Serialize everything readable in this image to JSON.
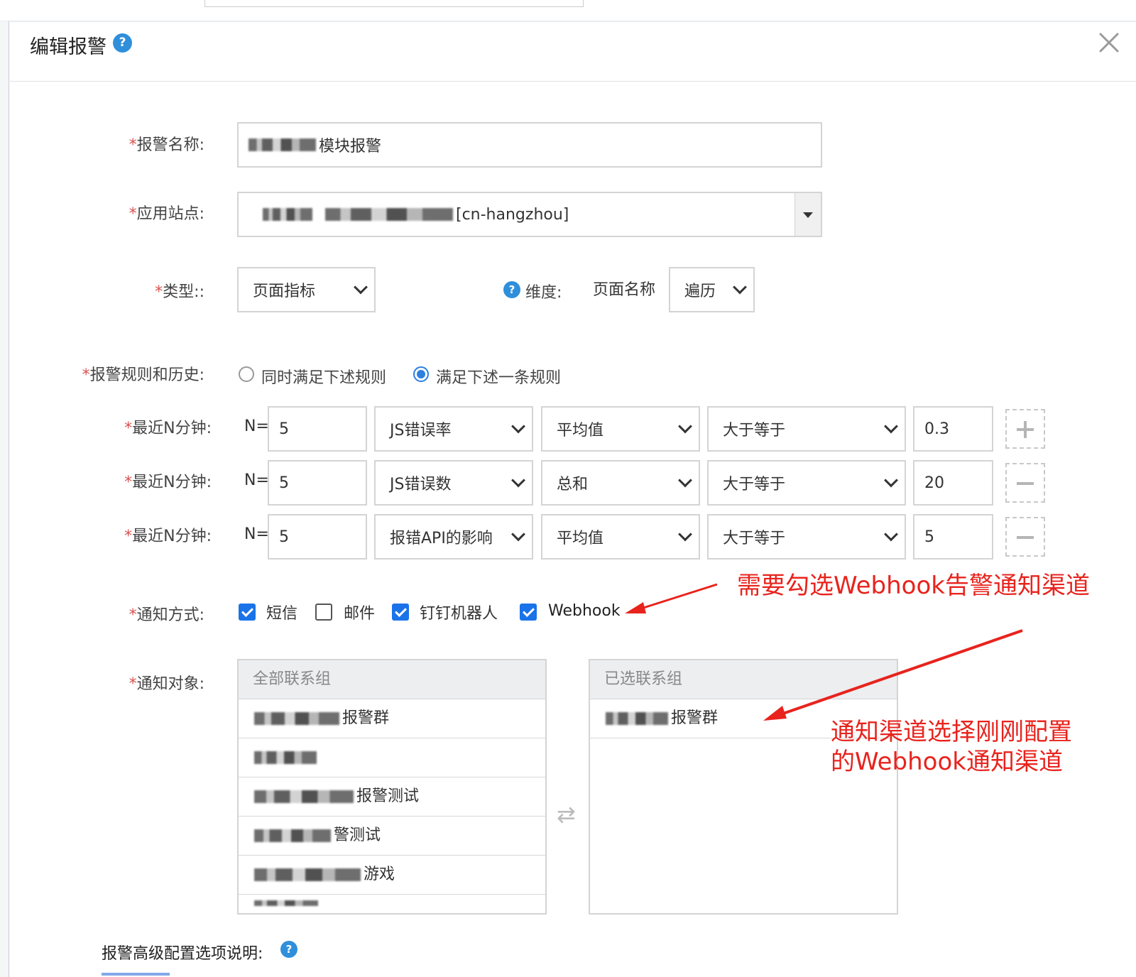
{
  "dialog": {
    "title": "编辑报警",
    "close_glyph": "✕",
    "help_glyph": "?"
  },
  "form": {
    "alert_name": {
      "label": "报警名称:",
      "value": "模块报警"
    },
    "site": {
      "label": "应用站点:",
      "value": "[cn-hangzhou]"
    },
    "type": {
      "label": "类型::",
      "value": "页面指标"
    },
    "dimension": {
      "label": "维度:",
      "prefix": "页面名称",
      "value": "遍历"
    },
    "rules": {
      "label": "报警规则和历史:",
      "options": [
        {
          "label": "同时满足下述规则",
          "selected": false
        },
        {
          "label": "满足下述一条规则",
          "selected": true
        }
      ],
      "rows": [
        {
          "label": "最近N分钟:",
          "n_prefix": "N=",
          "n": "5",
          "metric": "JS错误率",
          "agg": "平均值",
          "op": "大于等于",
          "threshold": "0.3",
          "action": "add"
        },
        {
          "label": "最近N分钟:",
          "n_prefix": "N=",
          "n": "5",
          "metric": "JS错误数",
          "agg": "总和",
          "op": "大于等于",
          "threshold": "20",
          "action": "remove"
        },
        {
          "label": "最近N分钟:",
          "n_prefix": "N=",
          "n": "5",
          "metric": "报错API的影响",
          "agg": "平均值",
          "op": "大于等于",
          "threshold": "5",
          "action": "remove"
        }
      ]
    },
    "notify_method": {
      "label": "通知方式:",
      "options": [
        {
          "label": "短信",
          "checked": true
        },
        {
          "label": "邮件",
          "checked": false
        },
        {
          "label": "钉钉机器人",
          "checked": true
        },
        {
          "label": "Webhook",
          "checked": true
        }
      ]
    },
    "notify_target": {
      "label": "通知对象:",
      "all_title": "全部联系组",
      "selected_title": "已选联系组",
      "all_groups": [
        "报警群",
        "",
        "报警测试",
        "警测试",
        "游戏"
      ],
      "selected_groups": [
        "报警群"
      ],
      "transfer_glyph": "⇄"
    },
    "advanced": {
      "label": "报警高级配置选项说明:"
    }
  },
  "annotations": {
    "webhook_tip": "需要勾选Webhook告警通知渠道",
    "channel_tip_line1": "通知渠道选择刚刚配置",
    "channel_tip_line2": "的Webhook通知渠道"
  },
  "colors": {
    "accent": "#1a73e8",
    "help": "#2f8fdb",
    "annotation": "#e8231d",
    "required": "#d9534f"
  }
}
